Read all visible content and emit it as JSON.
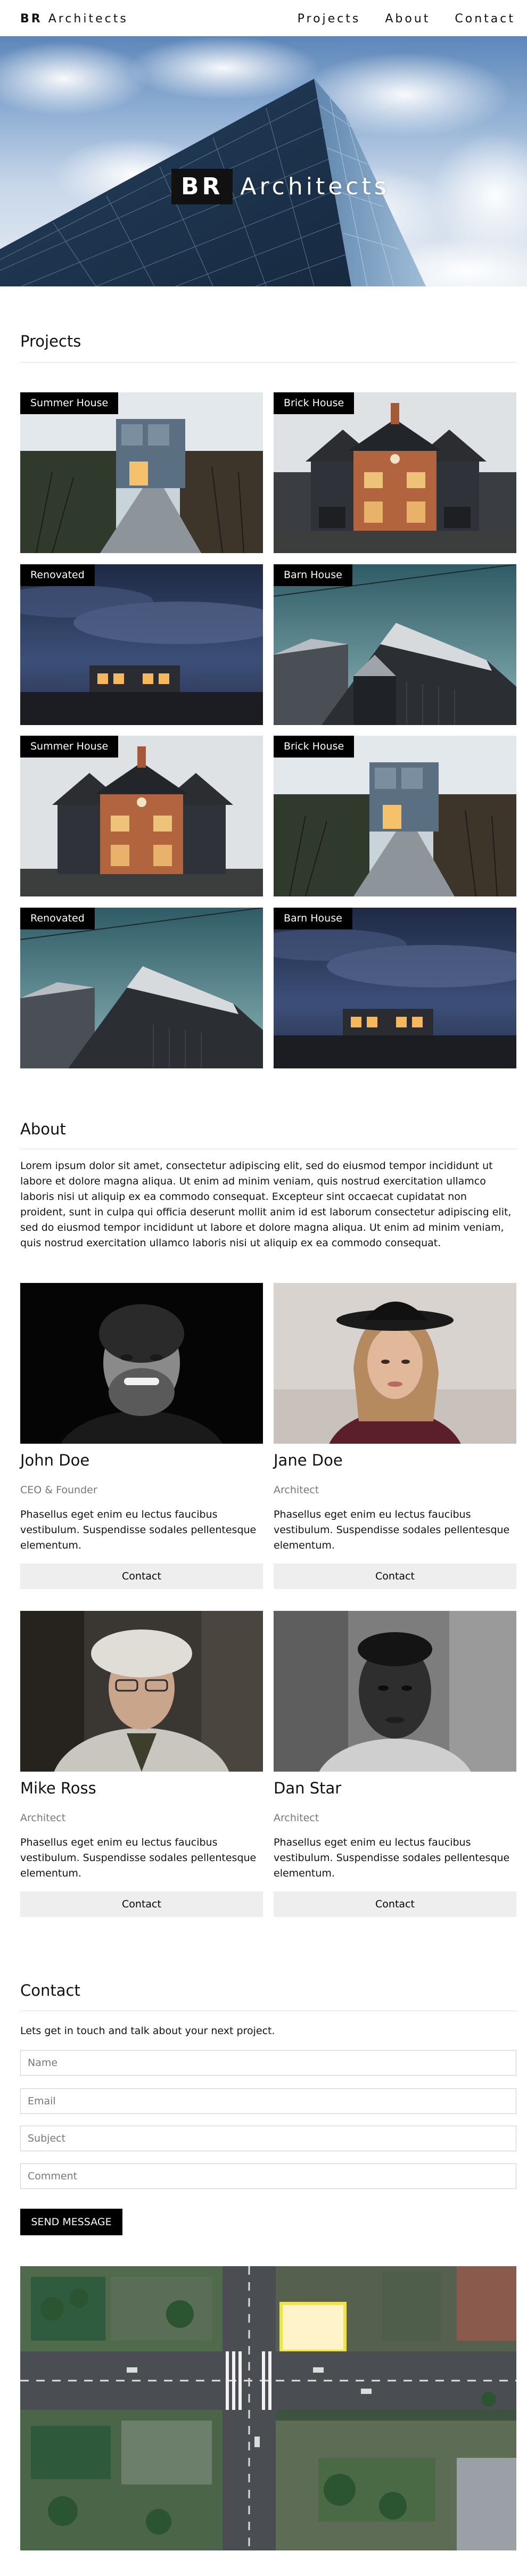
{
  "nav": {
    "brand_bold": "BR",
    "brand_rest": "Architects",
    "links": [
      "Projects",
      "About",
      "Contact"
    ]
  },
  "hero": {
    "title_bold": "BR",
    "title_rest": "Architects"
  },
  "projects": {
    "title": "Projects",
    "items": [
      {
        "label": "Summer House"
      },
      {
        "label": "Brick House"
      },
      {
        "label": "Renovated"
      },
      {
        "label": "Barn House"
      },
      {
        "label": "Summer House"
      },
      {
        "label": "Brick House"
      },
      {
        "label": "Renovated"
      },
      {
        "label": "Barn House"
      }
    ]
  },
  "about": {
    "title": "About",
    "text": "Lorem ipsum dolor sit amet, consectetur adipiscing elit, sed do eiusmod tempor incididunt ut labore et dolore magna aliqua. Ut enim ad minim veniam, quis nostrud exercitation ullamco laboris nisi ut aliquip ex ea commodo consequat. Excepteur sint occaecat cupidatat non proident, sunt in culpa qui officia deserunt mollit anim id est laborum consectetur adipiscing elit, sed do eiusmod tempor incididunt ut labore et dolore magna aliqua. Ut enim ad minim veniam, quis nostrud exercitation ullamco laboris nisi ut aliquip ex ea commodo consequat.",
    "team": [
      {
        "name": "John Doe",
        "role": "CEO & Founder",
        "desc": "Phasellus eget enim eu lectus faucibus vestibulum. Suspendisse sodales pellentesque elementum.",
        "button": "Contact"
      },
      {
        "name": "Jane Doe",
        "role": "Architect",
        "desc": "Phasellus eget enim eu lectus faucibus vestibulum. Suspendisse sodales pellentesque elementum.",
        "button": "Contact"
      },
      {
        "name": "Mike Ross",
        "role": "Architect",
        "desc": "Phasellus eget enim eu lectus faucibus vestibulum. Suspendisse sodales pellentesque elementum.",
        "button": "Contact"
      },
      {
        "name": "Dan Star",
        "role": "Architect",
        "desc": "Phasellus eget enim eu lectus faucibus vestibulum. Suspendisse sodales pellentesque elementum.",
        "button": "Contact"
      }
    ]
  },
  "contact": {
    "title": "Contact",
    "lead": "Lets get in touch and talk about your next project.",
    "fields": {
      "name_placeholder": "Name",
      "email_placeholder": "Email",
      "subject_placeholder": "Subject",
      "comment_placeholder": "Comment"
    },
    "send_label": "SEND MESSAGE"
  },
  "colors": {
    "nav_bg": "#ffffff",
    "label_bg": "#000000",
    "button_bg": "#eeeeee",
    "send_bg": "#000000"
  }
}
